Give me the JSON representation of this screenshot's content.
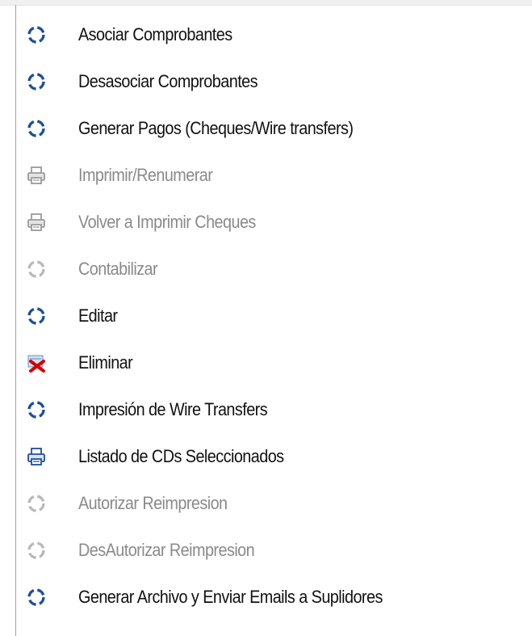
{
  "menu": {
    "items": [
      {
        "label": "Asociar Comprobantes",
        "icon": "refresh-circle-icon",
        "enabled": true
      },
      {
        "label": "Desasociar Comprobantes",
        "icon": "refresh-circle-icon",
        "enabled": true
      },
      {
        "label": "Generar Pagos (Cheques/Wire transfers)",
        "icon": "refresh-circle-icon",
        "enabled": true
      },
      {
        "label": "Imprimir/Renumerar",
        "icon": "printer-icon",
        "enabled": false
      },
      {
        "label": "Volver a Imprimir Cheques",
        "icon": "printer-icon",
        "enabled": false
      },
      {
        "label": "Contabilizar",
        "icon": "refresh-circle-icon",
        "enabled": false
      },
      {
        "label": "Editar",
        "icon": "refresh-circle-icon",
        "enabled": true
      },
      {
        "label": "Eliminar",
        "icon": "delete-x-icon",
        "enabled": true
      },
      {
        "label": "Impresión de Wire Transfers",
        "icon": "refresh-circle-icon",
        "enabled": true
      },
      {
        "label": "Listado de CDs Seleccionados",
        "icon": "printer-icon",
        "enabled": true
      },
      {
        "label": "Autorizar Reimpresion",
        "icon": "refresh-circle-icon",
        "enabled": false
      },
      {
        "label": "DesAutorizar Reimpresion",
        "icon": "refresh-circle-icon",
        "enabled": false
      },
      {
        "label": "Generar Archivo y Enviar Emails a Suplidores",
        "icon": "refresh-circle-icon",
        "enabled": true
      }
    ]
  },
  "colors": {
    "icon_active": "#1f4e99",
    "icon_disabled": "#b9b9b9",
    "text_active": "#111111",
    "text_disabled": "#8a8a8a",
    "delete_red": "#d40000"
  }
}
